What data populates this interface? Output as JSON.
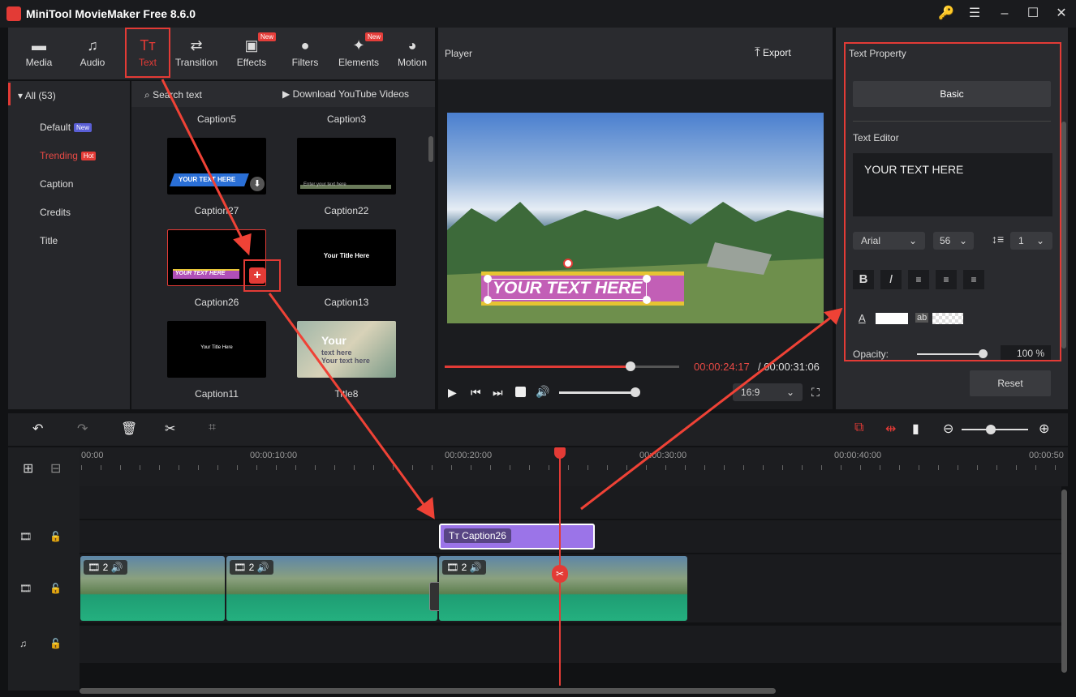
{
  "window": {
    "title": "MiniTool MovieMaker Free 8.6.0"
  },
  "toolbar": {
    "tabs": [
      {
        "label": "Media",
        "icon": "folder-icon"
      },
      {
        "label": "Audio",
        "icon": "music-icon"
      },
      {
        "label": "Text",
        "icon": "text-icon",
        "active": true
      },
      {
        "label": "Transition",
        "icon": "transition-icon"
      },
      {
        "label": "Effects",
        "icon": "effects-icon",
        "badge": "New"
      },
      {
        "label": "Filters",
        "icon": "filters-icon"
      },
      {
        "label": "Elements",
        "icon": "elements-icon",
        "badge": "New"
      },
      {
        "label": "Motion",
        "icon": "motion-icon"
      }
    ]
  },
  "sidebar": {
    "header": "All (53)",
    "items": [
      {
        "label": "Default",
        "badge": "New"
      },
      {
        "label": "Trending",
        "badge": "Hot",
        "active": true
      },
      {
        "label": "Caption"
      },
      {
        "label": "Credits"
      },
      {
        "label": "Title"
      }
    ]
  },
  "gallery": {
    "search_placeholder": "Search text",
    "download_label": "Download YouTube Videos",
    "top_captions": [
      "Caption5",
      "Caption3"
    ],
    "items": [
      {
        "name": "Caption27",
        "thumb_text": "YOUR TEXT HERE"
      },
      {
        "name": "Caption22",
        "thumb_text": "Enter your text here"
      },
      {
        "name": "Caption26",
        "thumb_text": "YOUR TEXT HERE"
      },
      {
        "name": "Caption13",
        "thumb_text": "Your  Title Here"
      },
      {
        "name": "Caption11",
        "thumb_text": "Your  Title Here"
      },
      {
        "name": "Title8",
        "thumb_text": "Your",
        "thumb_sub1": "text here",
        "thumb_sub2": "Your text here"
      }
    ]
  },
  "player": {
    "title": "Player",
    "export_label": "Export",
    "overlay_text": "YOUR TEXT HERE",
    "current_time": "00:00:24:17",
    "total_time": "00:00:31:06",
    "aspect": "16:9",
    "progress": 0.72,
    "volume": 1.0
  },
  "properties": {
    "title": "Text Property",
    "basic_label": "Basic",
    "editor_label": "Text Editor",
    "editor_text": "YOUR TEXT HERE",
    "font": "Arial",
    "size": "56",
    "line_spacing": "1",
    "opacity_label": "Opacity:",
    "opacity_value": "100 %",
    "reset_label": "Reset",
    "color_swatch": "#ffffff",
    "bg_label": "ab"
  },
  "timeline": {
    "ruler_labels": [
      "00:00",
      "00:00:10:00",
      "00:00:20:00",
      "00:00:30:00",
      "00:00:40:00",
      "00:00:50"
    ],
    "text_clip_label": "Caption26",
    "clips": [
      {
        "count": "2"
      },
      {
        "count": "2"
      },
      {
        "count": "2"
      }
    ]
  },
  "colors": {
    "accent": "#e33b36",
    "clip_purple": "#9b74e8",
    "audio_green": "#1fb07f"
  }
}
